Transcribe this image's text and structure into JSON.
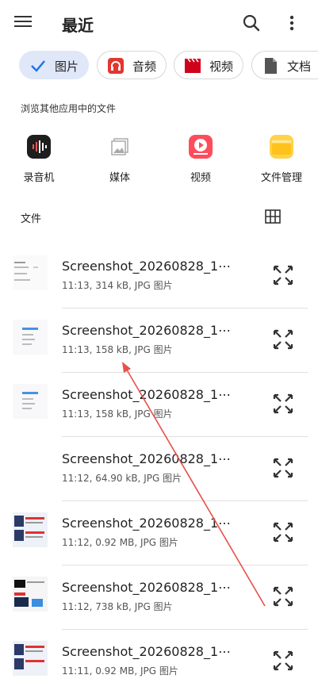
{
  "header": {
    "title": "最近"
  },
  "chips": [
    {
      "label": "图片",
      "icon": "check-icon",
      "selected": true
    },
    {
      "label": "音频",
      "icon": "headphones-icon",
      "selected": false
    },
    {
      "label": "视频",
      "icon": "clapper-icon",
      "selected": false
    },
    {
      "label": "文档",
      "icon": "document-icon",
      "selected": false
    }
  ],
  "apps_section": {
    "label": "浏览其他应用中的文件",
    "apps": [
      {
        "label": "录音机",
        "icon": "recorder-icon",
        "color": "#1e1e1e"
      },
      {
        "label": "媒体",
        "icon": "gallery-icon",
        "color": "#9e9e9e"
      },
      {
        "label": "视频",
        "icon": "video-app-icon",
        "color": "#ff4c5b"
      },
      {
        "label": "文件管理",
        "icon": "folder-icon",
        "color": "#ffd24a"
      }
    ]
  },
  "files_section": {
    "label": "文件",
    "view_toggle": "grid-view-icon"
  },
  "files": [
    {
      "name": "Screenshot_20260828_1⋯",
      "meta": "11:13, 314 kB, JPG 图片"
    },
    {
      "name": "Screenshot_20260828_1⋯",
      "meta": "11:13, 158 kB, JPG 图片"
    },
    {
      "name": "Screenshot_20260828_1⋯",
      "meta": "11:13, 158 kB, JPG 图片"
    },
    {
      "name": "Screenshot_20260828_1⋯",
      "meta": "11:12, 64.90 kB, JPG 图片"
    },
    {
      "name": "Screenshot_20260828_1⋯",
      "meta": "11:12, 0.92 MB, JPG 图片"
    },
    {
      "name": "Screenshot_20260828_1⋯",
      "meta": "11:12, 738 kB, JPG 图片"
    },
    {
      "name": "Screenshot_20260828_1⋯",
      "meta": "11:11, 0.92 MB, JPG 图片"
    }
  ],
  "colors": {
    "accent": "#1a73e8",
    "chip_selected_bg": "#dfe7f8",
    "annotation_arrow": "#e8504a"
  }
}
